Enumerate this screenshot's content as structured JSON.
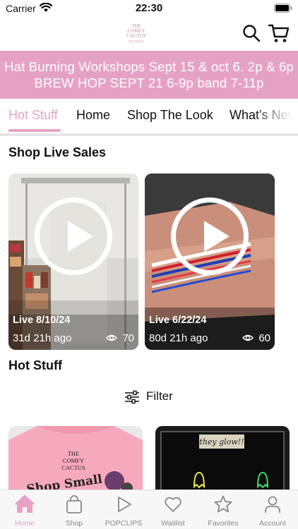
{
  "status_bar": {
    "carrier": "Carrier",
    "time": "22:30"
  },
  "header": {
    "logo_line1": "THE",
    "logo_line2": "COMFY",
    "logo_line3": "CACTUS",
    "logo_line4": "BOUTIQUE"
  },
  "banner": {
    "line1": "Hat Burning Workshops Sept 15 & oct 6. 2p & 6p",
    "line2": "BREW HOP SEPT 21 6-9p band 7-11p"
  },
  "tabs": [
    {
      "label": "Hot Stuff",
      "active": true
    },
    {
      "label": "Home",
      "active": false
    },
    {
      "label": "Shop The Look",
      "active": false
    },
    {
      "label": "What's New",
      "active": false
    }
  ],
  "live_sales": {
    "title": "Shop Live Sales",
    "cards": [
      {
        "date": "Live 8/10/24",
        "ago": "31d 21h ago",
        "views": "70"
      },
      {
        "date": "Live 6/22/24",
        "ago": "80d 21h ago",
        "views": "60"
      }
    ]
  },
  "hot_stuff": {
    "title": "Hot Stuff",
    "filter_label": "Filter",
    "products": [
      {
        "brand_line1": "THE",
        "brand_line2": "COMFY",
        "brand_line3": "CACTUS",
        "shirt_text": "Shop Small"
      },
      {
        "sign_text": "they glow!!"
      }
    ]
  },
  "bottom_nav": [
    {
      "label": "Home",
      "icon": "home-icon",
      "active": true
    },
    {
      "label": "Shop",
      "icon": "shopping-bag-icon",
      "active": false
    },
    {
      "label": "POPCLIPS",
      "icon": "play-icon",
      "active": false
    },
    {
      "label": "Waitlist",
      "icon": "heart-icon",
      "active": false
    },
    {
      "label": "Favorites",
      "icon": "star-icon",
      "active": false
    },
    {
      "label": "Account",
      "icon": "person-icon",
      "active": false
    }
  ],
  "colors": {
    "accent": "#e6a2c4",
    "inactive": "#888888"
  }
}
